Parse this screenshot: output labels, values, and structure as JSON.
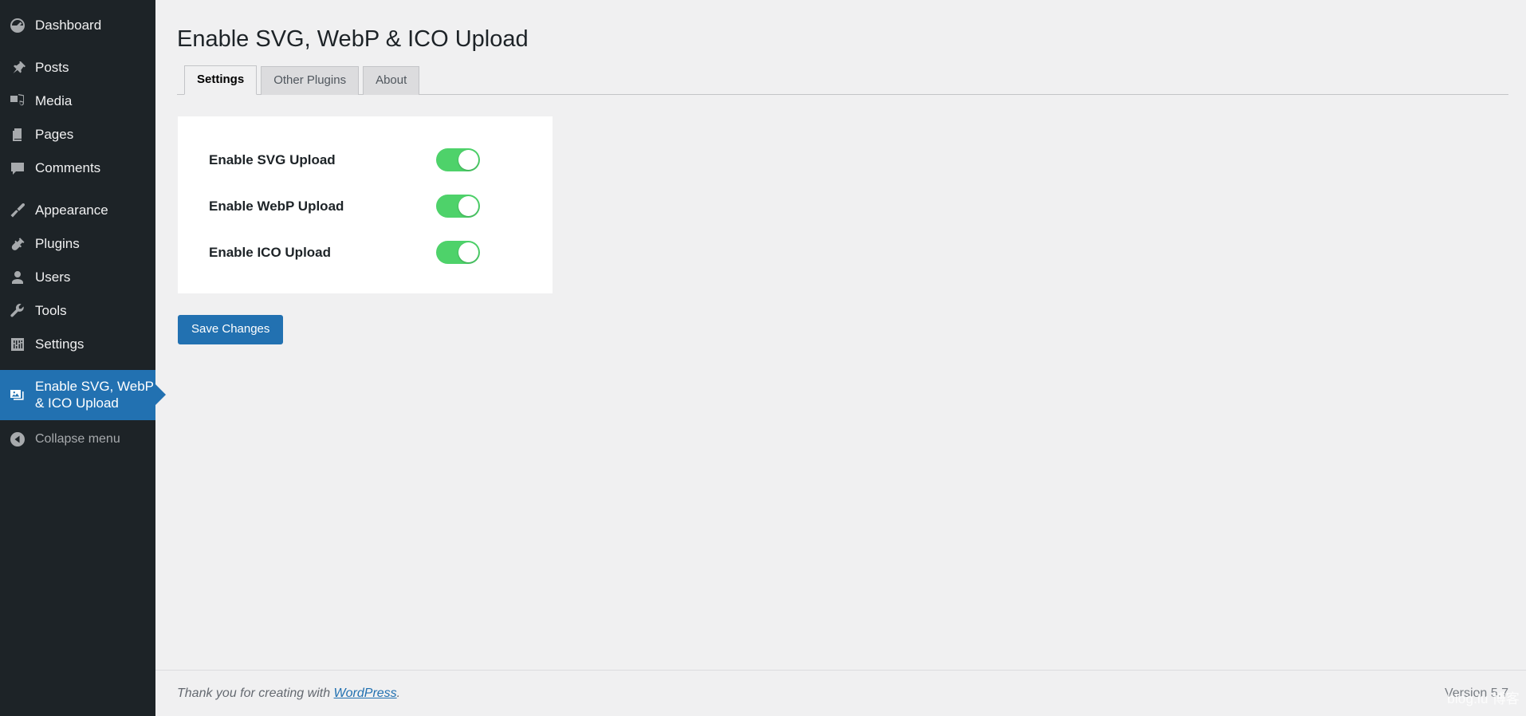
{
  "sidebar": {
    "items": [
      {
        "label": "Dashboard",
        "icon": "dashboard-icon",
        "active": false,
        "group": 0
      },
      {
        "label": "Posts",
        "icon": "pin-icon",
        "active": false,
        "group": 1
      },
      {
        "label": "Media",
        "icon": "media-icon",
        "active": false,
        "group": 1
      },
      {
        "label": "Pages",
        "icon": "pages-icon",
        "active": false,
        "group": 1
      },
      {
        "label": "Comments",
        "icon": "comments-icon",
        "active": false,
        "group": 1
      },
      {
        "label": "Appearance",
        "icon": "brush-icon",
        "active": false,
        "group": 2
      },
      {
        "label": "Plugins",
        "icon": "plug-icon",
        "active": false,
        "group": 2
      },
      {
        "label": "Users",
        "icon": "user-icon",
        "active": false,
        "group": 2
      },
      {
        "label": "Tools",
        "icon": "wrench-icon",
        "active": false,
        "group": 2
      },
      {
        "label": "Settings",
        "icon": "sliders-icon",
        "active": false,
        "group": 2
      },
      {
        "label": "Enable SVG, WebP\n& ICO Upload",
        "icon": "images-icon",
        "active": true,
        "group": 3
      }
    ],
    "collapse": {
      "label": "Collapse menu",
      "icon": "chevron-left-circle-icon"
    },
    "active_color": "#2271b1",
    "background_color": "#1d2327"
  },
  "header": {
    "title": "Enable SVG, WebP & ICO Upload"
  },
  "tabs": [
    {
      "label": "Settings",
      "active": true
    },
    {
      "label": "Other Plugins",
      "active": false
    },
    {
      "label": "About",
      "active": false
    }
  ],
  "settings": {
    "rows": [
      {
        "label": "Enable SVG Upload",
        "enabled": true
      },
      {
        "label": "Enable WebP Upload",
        "enabled": true
      },
      {
        "label": "Enable ICO Upload",
        "enabled": true
      }
    ],
    "toggle_on_color": "#4ed26a",
    "toggle_off_color": "#c3c4c7"
  },
  "actions": {
    "save_label": "Save Changes",
    "save_color": "#2271b1"
  },
  "footer": {
    "thanks_prefix": "Thank you for creating with ",
    "wordpress_link": "WordPress",
    "thanks_suffix": ".",
    "version": "Version 5.7",
    "watermark": "blog.lu 博客"
  }
}
